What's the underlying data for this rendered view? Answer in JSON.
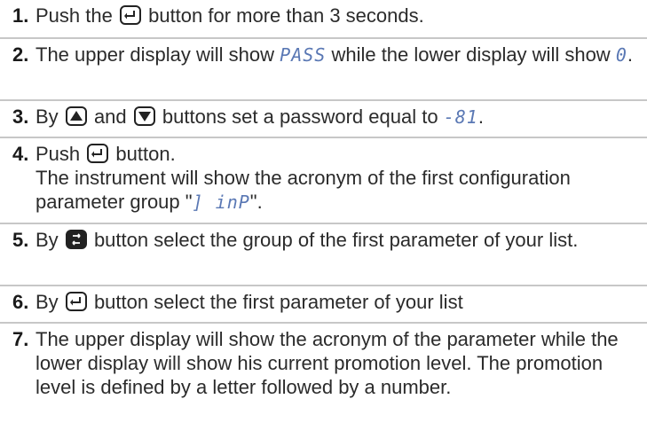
{
  "steps": [
    {
      "num": "1.",
      "a": "Push the",
      "b": "button for more than 3 seconds."
    },
    {
      "num": "2.",
      "a": "The upper display will show",
      "seg1": "PASS",
      "b": "while the lower display will show",
      "seg2": "0",
      "c": "."
    },
    {
      "num": "3.",
      "a": "By",
      "b": "and",
      "c": "buttons set a password equal to",
      "seg1": "-81",
      "d": "."
    },
    {
      "num": "4.",
      "a": "Push",
      "b": "button.",
      "c": "The instrument will show the acronym of the first configuration parameter group \"",
      "seg1": "] inP",
      "d": "\"."
    },
    {
      "num": "5.",
      "a": "By",
      "b": "button select the group of the first parameter of your list."
    },
    {
      "num": "6.",
      "a": "By",
      "b": "button select the first parameter of your list"
    },
    {
      "num": "7.",
      "a": "The upper display will show the acronym of the parameter while the lower display will show his current promotion level. The promotion level is defined by a letter followed by a number."
    }
  ],
  "icons": {
    "enter": "enter-button-icon",
    "up": "up-arrow-button-icon",
    "down": "down-arrow-button-icon",
    "scroll": "scroll-button-icon"
  }
}
